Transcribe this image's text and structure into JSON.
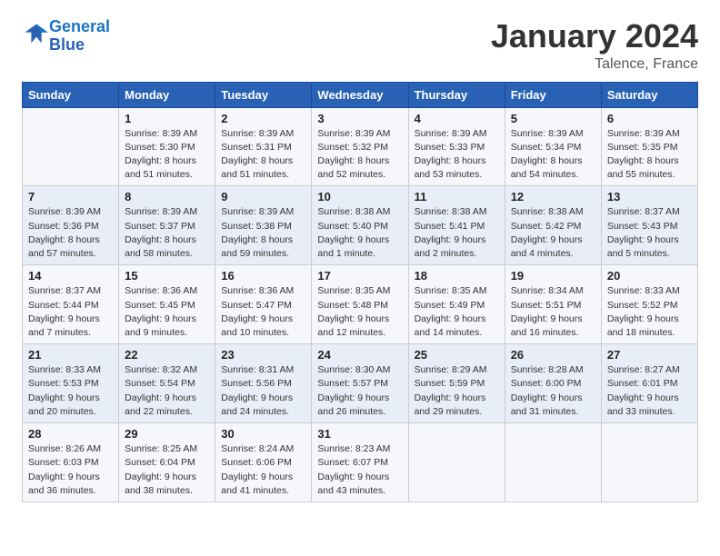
{
  "logo": {
    "text_general": "General",
    "text_blue": "Blue"
  },
  "header": {
    "title": "January 2024",
    "subtitle": "Talence, France"
  },
  "columns": [
    "Sunday",
    "Monday",
    "Tuesday",
    "Wednesday",
    "Thursday",
    "Friday",
    "Saturday"
  ],
  "weeks": [
    [
      {
        "day": "",
        "sunrise": "",
        "sunset": "",
        "daylight": ""
      },
      {
        "day": "1",
        "sunrise": "Sunrise: 8:39 AM",
        "sunset": "Sunset: 5:30 PM",
        "daylight": "Daylight: 8 hours and 51 minutes."
      },
      {
        "day": "2",
        "sunrise": "Sunrise: 8:39 AM",
        "sunset": "Sunset: 5:31 PM",
        "daylight": "Daylight: 8 hours and 51 minutes."
      },
      {
        "day": "3",
        "sunrise": "Sunrise: 8:39 AM",
        "sunset": "Sunset: 5:32 PM",
        "daylight": "Daylight: 8 hours and 52 minutes."
      },
      {
        "day": "4",
        "sunrise": "Sunrise: 8:39 AM",
        "sunset": "Sunset: 5:33 PM",
        "daylight": "Daylight: 8 hours and 53 minutes."
      },
      {
        "day": "5",
        "sunrise": "Sunrise: 8:39 AM",
        "sunset": "Sunset: 5:34 PM",
        "daylight": "Daylight: 8 hours and 54 minutes."
      },
      {
        "day": "6",
        "sunrise": "Sunrise: 8:39 AM",
        "sunset": "Sunset: 5:35 PM",
        "daylight": "Daylight: 8 hours and 55 minutes."
      }
    ],
    [
      {
        "day": "7",
        "sunrise": "Sunrise: 8:39 AM",
        "sunset": "Sunset: 5:36 PM",
        "daylight": "Daylight: 8 hours and 57 minutes."
      },
      {
        "day": "8",
        "sunrise": "Sunrise: 8:39 AM",
        "sunset": "Sunset: 5:37 PM",
        "daylight": "Daylight: 8 hours and 58 minutes."
      },
      {
        "day": "9",
        "sunrise": "Sunrise: 8:39 AM",
        "sunset": "Sunset: 5:38 PM",
        "daylight": "Daylight: 8 hours and 59 minutes."
      },
      {
        "day": "10",
        "sunrise": "Sunrise: 8:38 AM",
        "sunset": "Sunset: 5:40 PM",
        "daylight": "Daylight: 9 hours and 1 minute."
      },
      {
        "day": "11",
        "sunrise": "Sunrise: 8:38 AM",
        "sunset": "Sunset: 5:41 PM",
        "daylight": "Daylight: 9 hours and 2 minutes."
      },
      {
        "day": "12",
        "sunrise": "Sunrise: 8:38 AM",
        "sunset": "Sunset: 5:42 PM",
        "daylight": "Daylight: 9 hours and 4 minutes."
      },
      {
        "day": "13",
        "sunrise": "Sunrise: 8:37 AM",
        "sunset": "Sunset: 5:43 PM",
        "daylight": "Daylight: 9 hours and 5 minutes."
      }
    ],
    [
      {
        "day": "14",
        "sunrise": "Sunrise: 8:37 AM",
        "sunset": "Sunset: 5:44 PM",
        "daylight": "Daylight: 9 hours and 7 minutes."
      },
      {
        "day": "15",
        "sunrise": "Sunrise: 8:36 AM",
        "sunset": "Sunset: 5:45 PM",
        "daylight": "Daylight: 9 hours and 9 minutes."
      },
      {
        "day": "16",
        "sunrise": "Sunrise: 8:36 AM",
        "sunset": "Sunset: 5:47 PM",
        "daylight": "Daylight: 9 hours and 10 minutes."
      },
      {
        "day": "17",
        "sunrise": "Sunrise: 8:35 AM",
        "sunset": "Sunset: 5:48 PM",
        "daylight": "Daylight: 9 hours and 12 minutes."
      },
      {
        "day": "18",
        "sunrise": "Sunrise: 8:35 AM",
        "sunset": "Sunset: 5:49 PM",
        "daylight": "Daylight: 9 hours and 14 minutes."
      },
      {
        "day": "19",
        "sunrise": "Sunrise: 8:34 AM",
        "sunset": "Sunset: 5:51 PM",
        "daylight": "Daylight: 9 hours and 16 minutes."
      },
      {
        "day": "20",
        "sunrise": "Sunrise: 8:33 AM",
        "sunset": "Sunset: 5:52 PM",
        "daylight": "Daylight: 9 hours and 18 minutes."
      }
    ],
    [
      {
        "day": "21",
        "sunrise": "Sunrise: 8:33 AM",
        "sunset": "Sunset: 5:53 PM",
        "daylight": "Daylight: 9 hours and 20 minutes."
      },
      {
        "day": "22",
        "sunrise": "Sunrise: 8:32 AM",
        "sunset": "Sunset: 5:54 PM",
        "daylight": "Daylight: 9 hours and 22 minutes."
      },
      {
        "day": "23",
        "sunrise": "Sunrise: 8:31 AM",
        "sunset": "Sunset: 5:56 PM",
        "daylight": "Daylight: 9 hours and 24 minutes."
      },
      {
        "day": "24",
        "sunrise": "Sunrise: 8:30 AM",
        "sunset": "Sunset: 5:57 PM",
        "daylight": "Daylight: 9 hours and 26 minutes."
      },
      {
        "day": "25",
        "sunrise": "Sunrise: 8:29 AM",
        "sunset": "Sunset: 5:59 PM",
        "daylight": "Daylight: 9 hours and 29 minutes."
      },
      {
        "day": "26",
        "sunrise": "Sunrise: 8:28 AM",
        "sunset": "Sunset: 6:00 PM",
        "daylight": "Daylight: 9 hours and 31 minutes."
      },
      {
        "day": "27",
        "sunrise": "Sunrise: 8:27 AM",
        "sunset": "Sunset: 6:01 PM",
        "daylight": "Daylight: 9 hours and 33 minutes."
      }
    ],
    [
      {
        "day": "28",
        "sunrise": "Sunrise: 8:26 AM",
        "sunset": "Sunset: 6:03 PM",
        "daylight": "Daylight: 9 hours and 36 minutes."
      },
      {
        "day": "29",
        "sunrise": "Sunrise: 8:25 AM",
        "sunset": "Sunset: 6:04 PM",
        "daylight": "Daylight: 9 hours and 38 minutes."
      },
      {
        "day": "30",
        "sunrise": "Sunrise: 8:24 AM",
        "sunset": "Sunset: 6:06 PM",
        "daylight": "Daylight: 9 hours and 41 minutes."
      },
      {
        "day": "31",
        "sunrise": "Sunrise: 8:23 AM",
        "sunset": "Sunset: 6:07 PM",
        "daylight": "Daylight: 9 hours and 43 minutes."
      },
      {
        "day": "",
        "sunrise": "",
        "sunset": "",
        "daylight": ""
      },
      {
        "day": "",
        "sunrise": "",
        "sunset": "",
        "daylight": ""
      },
      {
        "day": "",
        "sunrise": "",
        "sunset": "",
        "daylight": ""
      }
    ]
  ]
}
